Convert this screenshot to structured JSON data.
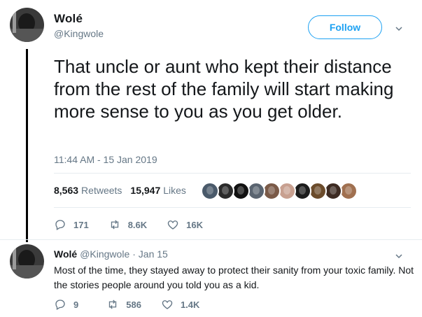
{
  "main_tweet": {
    "author_name": "Wolé",
    "author_handle": "@Kingwole",
    "follow_label": "Follow",
    "text": "That uncle or aunt who kept their distance from the rest of the family will start making more sense to you as you get older.",
    "timestamp": "11:44 AM - 15 Jan 2019",
    "retweets_count": "8,563",
    "retweets_label": "Retweets",
    "likes_count": "15,947",
    "likes_label": "Likes",
    "likers": [
      {
        "icon": "liker-avatar",
        "color": "#4a5a6a"
      },
      {
        "icon": "liker-avatar",
        "color": "#2b2b2b"
      },
      {
        "icon": "liker-avatar",
        "color": "#111111"
      },
      {
        "icon": "liker-avatar",
        "color": "#5a6470"
      },
      {
        "icon": "liker-avatar",
        "color": "#7a5a48"
      },
      {
        "icon": "liker-avatar",
        "color": "#c8a090"
      },
      {
        "icon": "liker-avatar",
        "color": "#1c1c1c"
      },
      {
        "icon": "liker-avatar",
        "color": "#6b4b2b"
      },
      {
        "icon": "liker-avatar",
        "color": "#3d2b22"
      },
      {
        "icon": "liker-avatar",
        "color": "#a07050"
      }
    ],
    "actions": {
      "replies": "171",
      "retweets": "8.6K",
      "likes": "16K"
    }
  },
  "reply_tweet": {
    "author_name": "Wolé",
    "author_handle": "@Kingwole",
    "date": "· Jan 15",
    "text": "Most of the time, they stayed away to protect their sanity from your toxic family. Not the stories people around you told you as a kid.",
    "actions": {
      "replies": "9",
      "retweets": "586",
      "likes": "1.4K"
    }
  },
  "colors": {
    "accent": "#1da1f2",
    "secondary_text": "#657786",
    "primary_text": "#14171a"
  }
}
